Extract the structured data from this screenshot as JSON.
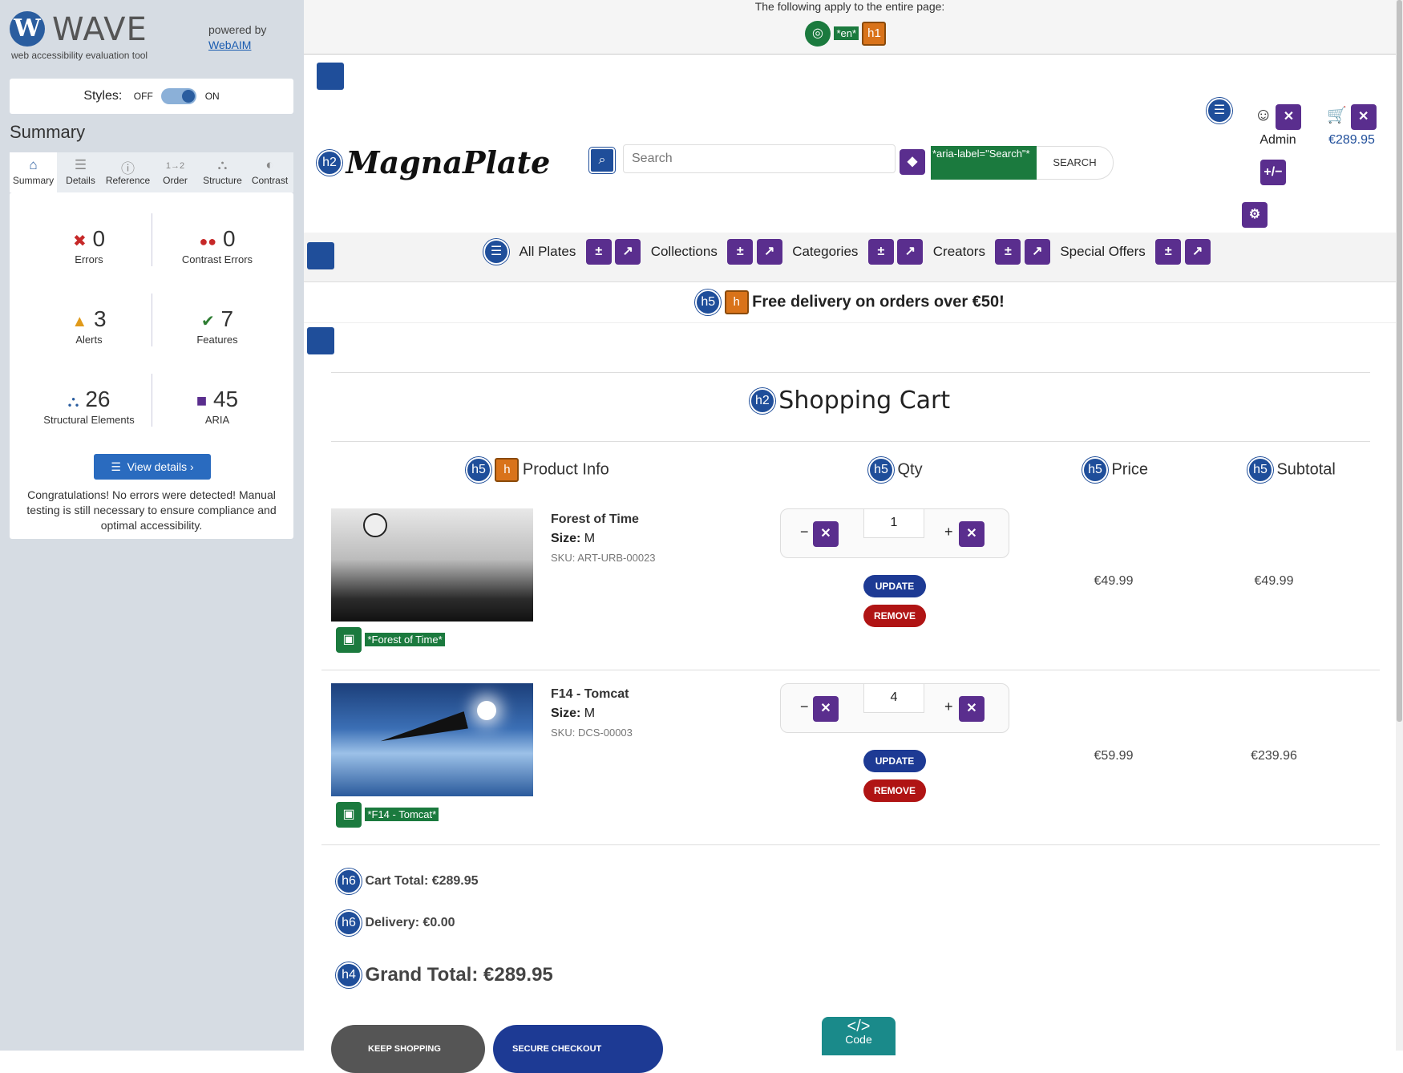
{
  "sidebar": {
    "logo_letter": "W",
    "logo_title": "WAVE",
    "logo_subtitle": "web accessibility evaluation tool",
    "powered_by": "powered by",
    "powered_link": "WebAIM",
    "styles_label": "Styles:",
    "styles_off": "OFF",
    "styles_on": "ON",
    "summary_title": "Summary",
    "tabs": [
      {
        "label": "Summary",
        "icon": "home-icon"
      },
      {
        "label": "Details",
        "icon": "list-icon"
      },
      {
        "label": "Reference",
        "icon": "info-icon"
      },
      {
        "label": "Order",
        "icon": "order-icon"
      },
      {
        "label": "Structure",
        "icon": "structure-icon"
      },
      {
        "label": "Contrast",
        "icon": "contrast-icon"
      }
    ],
    "stats": {
      "errors": {
        "value": "0",
        "label": "Errors"
      },
      "contrast": {
        "value": "0",
        "label": "Contrast Errors"
      },
      "alerts": {
        "value": "3",
        "label": "Alerts"
      },
      "features": {
        "value": "7",
        "label": "Features"
      },
      "structural": {
        "value": "26",
        "label": "Structural Elements"
      },
      "aria": {
        "value": "45",
        "label": "ARIA"
      }
    },
    "view_details": "View details ›",
    "congrats": "Congratulations! No errors were detected! Manual testing is still necessary to ensure compliance and optimal accessibility."
  },
  "page_banner": {
    "text": "The following apply to the entire page:",
    "lang_label": "*en*",
    "h1_badge": "h1"
  },
  "header": {
    "brand": "MagnaPlate",
    "h2_badge": "h2",
    "search_placeholder": "Search",
    "aria_label_text": "*aria-label=\"Search\"*",
    "search_button": "SEARCH",
    "account_label": "Admin",
    "cart_total": "€289.95",
    "plusminus": "+/−"
  },
  "nav": {
    "items": [
      "All Plates",
      "Collections",
      "Categories",
      "Creators",
      "Special Offers"
    ]
  },
  "promo": {
    "badge": "h5",
    "text": "Free delivery on orders over €50!"
  },
  "cart": {
    "title": "Shopping Cart",
    "title_badge": "h2",
    "columns": [
      {
        "label": "Product Info",
        "badge": "h5"
      },
      {
        "label": "Qty",
        "badge": "h5"
      },
      {
        "label": "Price",
        "badge": "h5"
      },
      {
        "label": "Subtotal",
        "badge": "h5"
      }
    ],
    "size_label": "Size:",
    "update_label": "UPDATE",
    "remove_label": "REMOVE",
    "items": [
      {
        "name": "Forest of Time",
        "size": "M",
        "sku": "SKU: ART-URB-00023",
        "alt": "*Forest of Time*",
        "qty": "1",
        "price": "€49.99",
        "subtotal": "€49.99"
      },
      {
        "name": "F14 - Tomcat",
        "size": "M",
        "sku": "SKU: DCS-00003",
        "alt": "*F14 - Tomcat*",
        "qty": "4",
        "price": "€59.99",
        "subtotal": "€239.96"
      }
    ],
    "totals": {
      "cart_total": "Cart Total: €289.95",
      "cart_badge": "h6",
      "delivery": "Delivery: €0.00",
      "delivery_badge": "h6",
      "grand_total": "Grand Total: €289.95",
      "grand_badge": "h4"
    },
    "keep_shopping": "KEEP SHOPPING",
    "secure_checkout": "SECURE CHECKOUT",
    "code_label": "Code"
  }
}
